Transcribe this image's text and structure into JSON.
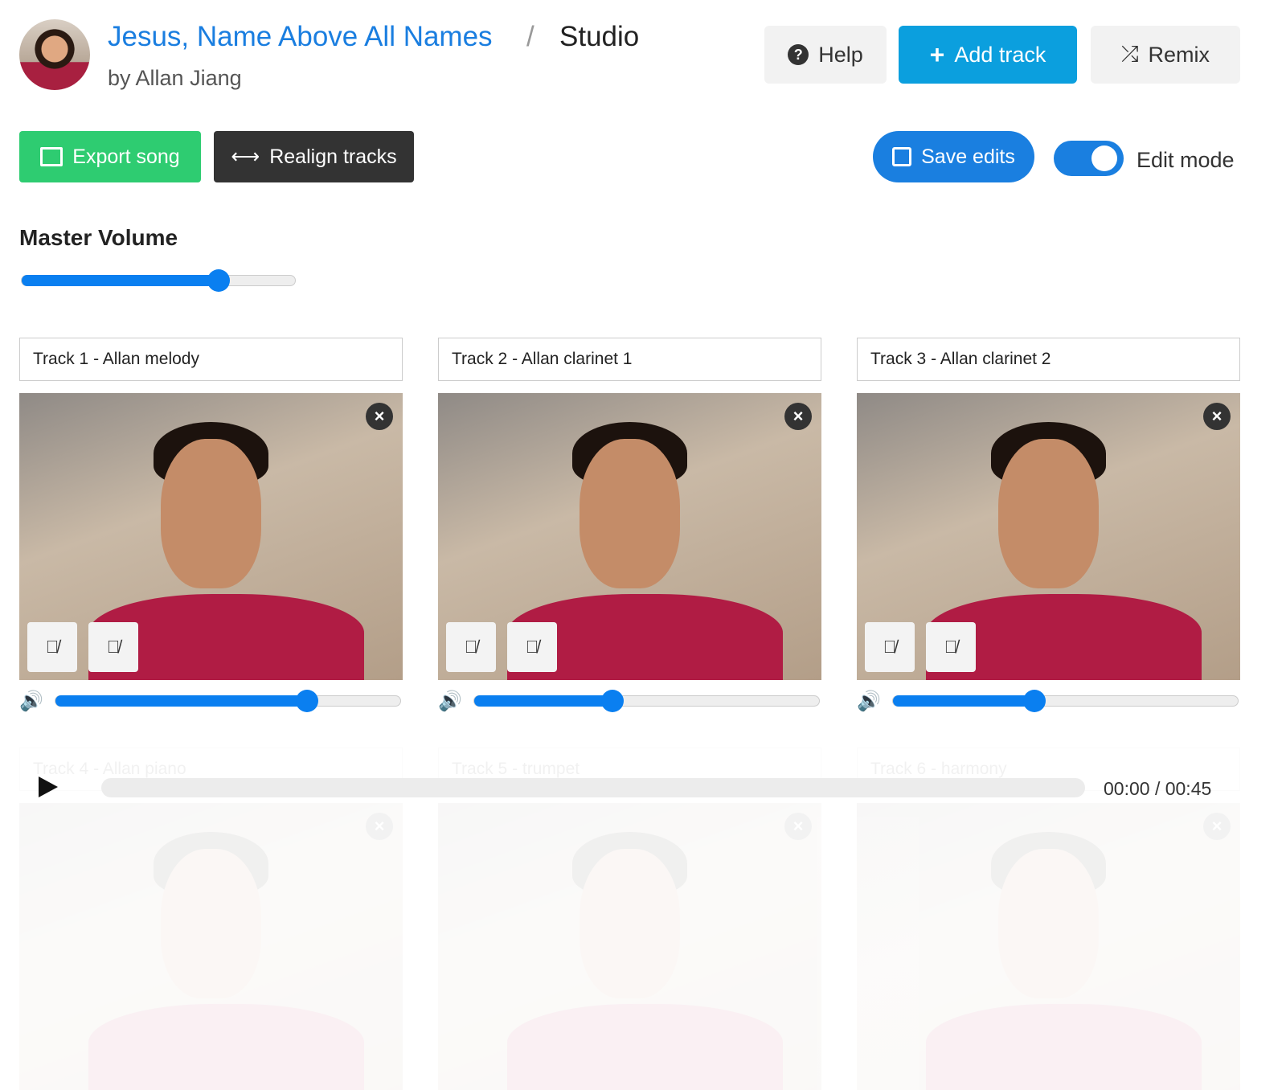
{
  "header": {
    "song_title": "Jesus, Name Above All Names",
    "separator": "/",
    "section": "Studio",
    "byline": "by Allan Jiang"
  },
  "buttons": {
    "help": "Help",
    "add_track": "Add track",
    "remix": "Remix",
    "export": "Export song",
    "realign": "Realign tracks",
    "save": "Save edits",
    "edit_mode": "Edit mode"
  },
  "edit_mode_on": true,
  "master": {
    "label": "Master Volume",
    "value": 0.72
  },
  "tracks": [
    {
      "name": "Track 1 - Allan melody",
      "volume": 0.73
    },
    {
      "name": "Track 2 - Allan clarinet 1",
      "volume": 0.4
    },
    {
      "name": "Track 3 - Allan clarinet 2",
      "volume": 0.41
    },
    {
      "name": "Track 4 - Allan piano"
    },
    {
      "name": "Track 5 - trumpet"
    },
    {
      "name": "Track 6 - harmony"
    }
  ],
  "player": {
    "time": "00:00 / 00:45",
    "progress": 0
  },
  "colors": {
    "link": "#1a7ee0",
    "add": "#0b9fde",
    "export": "#2ecc71",
    "realign": "#333333",
    "save": "#1a7fe0"
  },
  "icons": [
    "question-circle-icon",
    "plus-icon",
    "shuffle-icon",
    "film-icon",
    "arrows-h-icon",
    "floppy-icon",
    "eye-slash-icon",
    "microphone-slash-icon",
    "close-icon",
    "volume-icon",
    "play-icon"
  ]
}
